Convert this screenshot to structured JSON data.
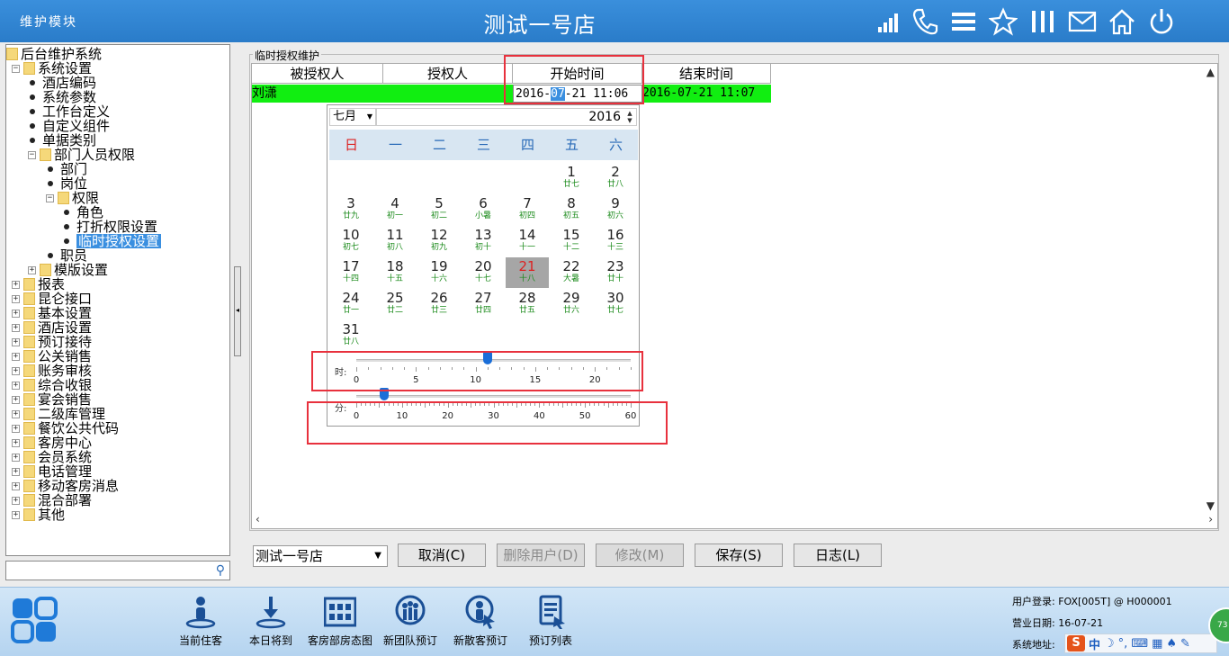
{
  "titlebar": {
    "module": "维护模块",
    "store_title": "测试一号店",
    "icons": [
      "signal-icon",
      "phone-icon",
      "menu-icon",
      "star-icon",
      "columns-icon",
      "mail-icon",
      "home-icon",
      "power-icon"
    ]
  },
  "tree": {
    "nodes": [
      {
        "label": "后台维护系统",
        "level": 0,
        "type": "root"
      },
      {
        "label": "系统设置",
        "level": 1,
        "type": "folder",
        "expanded": true
      },
      {
        "label": "酒店编码",
        "level": 2,
        "type": "leaf"
      },
      {
        "label": "系统参数",
        "level": 2,
        "type": "leaf"
      },
      {
        "label": "工作台定义",
        "level": 2,
        "type": "leaf"
      },
      {
        "label": "自定义组件",
        "level": 2,
        "type": "leaf"
      },
      {
        "label": "单据类别",
        "level": 2,
        "type": "leaf"
      },
      {
        "label": "部门人员权限",
        "level": 2,
        "type": "folder",
        "expanded": true
      },
      {
        "label": "部门",
        "level": 3,
        "type": "leaf"
      },
      {
        "label": "岗位",
        "level": 3,
        "type": "leaf"
      },
      {
        "label": "权限",
        "level": 3,
        "type": "folder",
        "expanded": true
      },
      {
        "label": "角色",
        "level": 4,
        "type": "leaf"
      },
      {
        "label": "打折权限设置",
        "level": 4,
        "type": "leaf"
      },
      {
        "label": "临时授权设置",
        "level": 4,
        "type": "leaf",
        "selected": true
      },
      {
        "label": "职员",
        "level": 3,
        "type": "leaf"
      },
      {
        "label": "模版设置",
        "level": 2,
        "type": "folder",
        "expanded": false
      },
      {
        "label": "报表",
        "level": 1,
        "type": "folder",
        "expanded": false
      },
      {
        "label": "昆仑接口",
        "level": 1,
        "type": "folder",
        "expanded": false
      },
      {
        "label": "基本设置",
        "level": 1,
        "type": "folder",
        "expanded": false
      },
      {
        "label": "酒店设置",
        "level": 1,
        "type": "folder",
        "expanded": false
      },
      {
        "label": "预订接待",
        "level": 1,
        "type": "folder",
        "expanded": false
      },
      {
        "label": "公关销售",
        "level": 1,
        "type": "folder",
        "expanded": false
      },
      {
        "label": "账务审核",
        "level": 1,
        "type": "folder",
        "expanded": false
      },
      {
        "label": "综合收银",
        "level": 1,
        "type": "folder",
        "expanded": false
      },
      {
        "label": "宴会销售",
        "level": 1,
        "type": "folder",
        "expanded": false
      },
      {
        "label": "二级库管理",
        "level": 1,
        "type": "folder",
        "expanded": false
      },
      {
        "label": "餐饮公共代码",
        "level": 1,
        "type": "folder",
        "expanded": false
      },
      {
        "label": "客房中心",
        "level": 1,
        "type": "folder",
        "expanded": false
      },
      {
        "label": "会员系统",
        "level": 1,
        "type": "folder",
        "expanded": false
      },
      {
        "label": "电话管理",
        "level": 1,
        "type": "folder",
        "expanded": false
      },
      {
        "label": "移动客房消息",
        "level": 1,
        "type": "folder",
        "expanded": false
      },
      {
        "label": "混合部署",
        "level": 1,
        "type": "folder",
        "expanded": false
      },
      {
        "label": "其他",
        "level": 1,
        "type": "folder",
        "expanded": false
      }
    ]
  },
  "group_title": "临时授权维护",
  "grid": {
    "headers": [
      "被授权人",
      "授权人",
      "开始时间",
      "结束时间"
    ],
    "row": {
      "grantee": "刘潇",
      "grantor": "",
      "start_pre": "2016-",
      "start_sel": "07",
      "start_post": "-21 11:06",
      "end": "2016-07-21 11:07"
    }
  },
  "calendar": {
    "month": "七月",
    "year": "2016",
    "weekdays": [
      "日",
      "一",
      "二",
      "三",
      "四",
      "五",
      "六"
    ],
    "first_col": 5,
    "selected_day": 21,
    "days": [
      {
        "d": "1",
        "l": "廿七"
      },
      {
        "d": "2",
        "l": "廿八"
      },
      {
        "d": "3",
        "l": "廿九"
      },
      {
        "d": "4",
        "l": "初一"
      },
      {
        "d": "5",
        "l": "初二"
      },
      {
        "d": "6",
        "l": "小暑"
      },
      {
        "d": "7",
        "l": "初四"
      },
      {
        "d": "8",
        "l": "初五"
      },
      {
        "d": "9",
        "l": "初六"
      },
      {
        "d": "10",
        "l": "初七"
      },
      {
        "d": "11",
        "l": "初八"
      },
      {
        "d": "12",
        "l": "初九"
      },
      {
        "d": "13",
        "l": "初十"
      },
      {
        "d": "14",
        "l": "十一"
      },
      {
        "d": "15",
        "l": "十二"
      },
      {
        "d": "16",
        "l": "十三"
      },
      {
        "d": "17",
        "l": "十四"
      },
      {
        "d": "18",
        "l": "十五"
      },
      {
        "d": "19",
        "l": "十六"
      },
      {
        "d": "20",
        "l": "十七"
      },
      {
        "d": "21",
        "l": "十八"
      },
      {
        "d": "22",
        "l": "大暑"
      },
      {
        "d": "23",
        "l": "廿十"
      },
      {
        "d": "24",
        "l": "廿一"
      },
      {
        "d": "25",
        "l": "廿二"
      },
      {
        "d": "26",
        "l": "廿三"
      },
      {
        "d": "27",
        "l": "廿四"
      },
      {
        "d": "28",
        "l": "廿五"
      },
      {
        "d": "29",
        "l": "廿六"
      },
      {
        "d": "30",
        "l": "廿七"
      },
      {
        "d": "31",
        "l": "廿八"
      }
    ],
    "hour_slider": {
      "label": "时:",
      "min": 0,
      "max": 23,
      "value": 11,
      "tick_labels": [
        "0",
        "5",
        "10",
        "15",
        "20"
      ]
    },
    "minute_slider": {
      "label": "分:",
      "min": 0,
      "max": 60,
      "value": 6,
      "tick_labels": [
        "0",
        "10",
        "20",
        "30",
        "40",
        "50",
        "60"
      ]
    }
  },
  "bottom": {
    "store_select": "测试一号店",
    "buttons": [
      {
        "label": "取消(C)",
        "enabled": true
      },
      {
        "label": "删除用户(D)",
        "enabled": false
      },
      {
        "label": "修改(M)",
        "enabled": false
      },
      {
        "label": "保存(S)",
        "enabled": true
      },
      {
        "label": "日志(L)",
        "enabled": true
      }
    ]
  },
  "taskbar": {
    "items": [
      {
        "label": "当前住客",
        "icon": "guest-icon"
      },
      {
        "label": "本日将到",
        "icon": "arrival-icon"
      },
      {
        "label": "客房部房态图",
        "icon": "room-status-icon"
      },
      {
        "label": "新团队预订",
        "icon": "group-booking-icon"
      },
      {
        "label": "新散客预订",
        "icon": "individual-booking-icon"
      },
      {
        "label": "预订列表",
        "icon": "booking-list-icon"
      }
    ],
    "user_login": "用户登录: FOX[005T] @ H000001",
    "business_date": "营业日期: 16-07-21",
    "system_address": "系统地址:",
    "ime_text": "中",
    "badge": "73"
  }
}
